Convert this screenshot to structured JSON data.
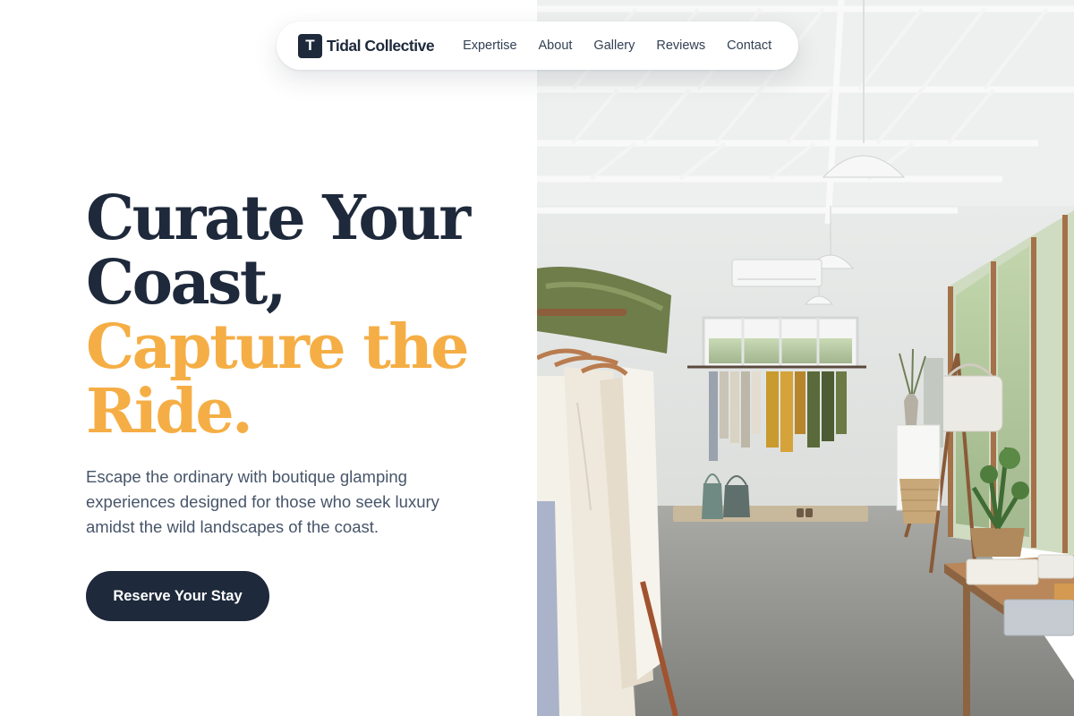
{
  "brand": {
    "mark": "T",
    "name": "Tidal Collective"
  },
  "nav": {
    "links": [
      "Expertise",
      "About",
      "Gallery",
      "Reviews",
      "Contact"
    ]
  },
  "hero": {
    "headline_dark_1": "Curate Your",
    "headline_dark_2": "Coast,",
    "headline_accent_1": "Capture the",
    "headline_accent_2": "Ride.",
    "lead": "Escape the ordinary with boutique glamping experiences designed for those who seek luxury amidst the wild landscapes of the coast.",
    "cta_label": "Reserve Your Stay"
  },
  "photo": {
    "subject": "bright boutique clothing store interior with white ceiling trusses, pendant lamps, clothing racks and plants",
    "icon": "photo"
  },
  "colors": {
    "dark": "#1e293b",
    "accent": "#f5ae45",
    "body_text": "#475569",
    "nav_text": "#334155",
    "background": "#ffffff"
  }
}
